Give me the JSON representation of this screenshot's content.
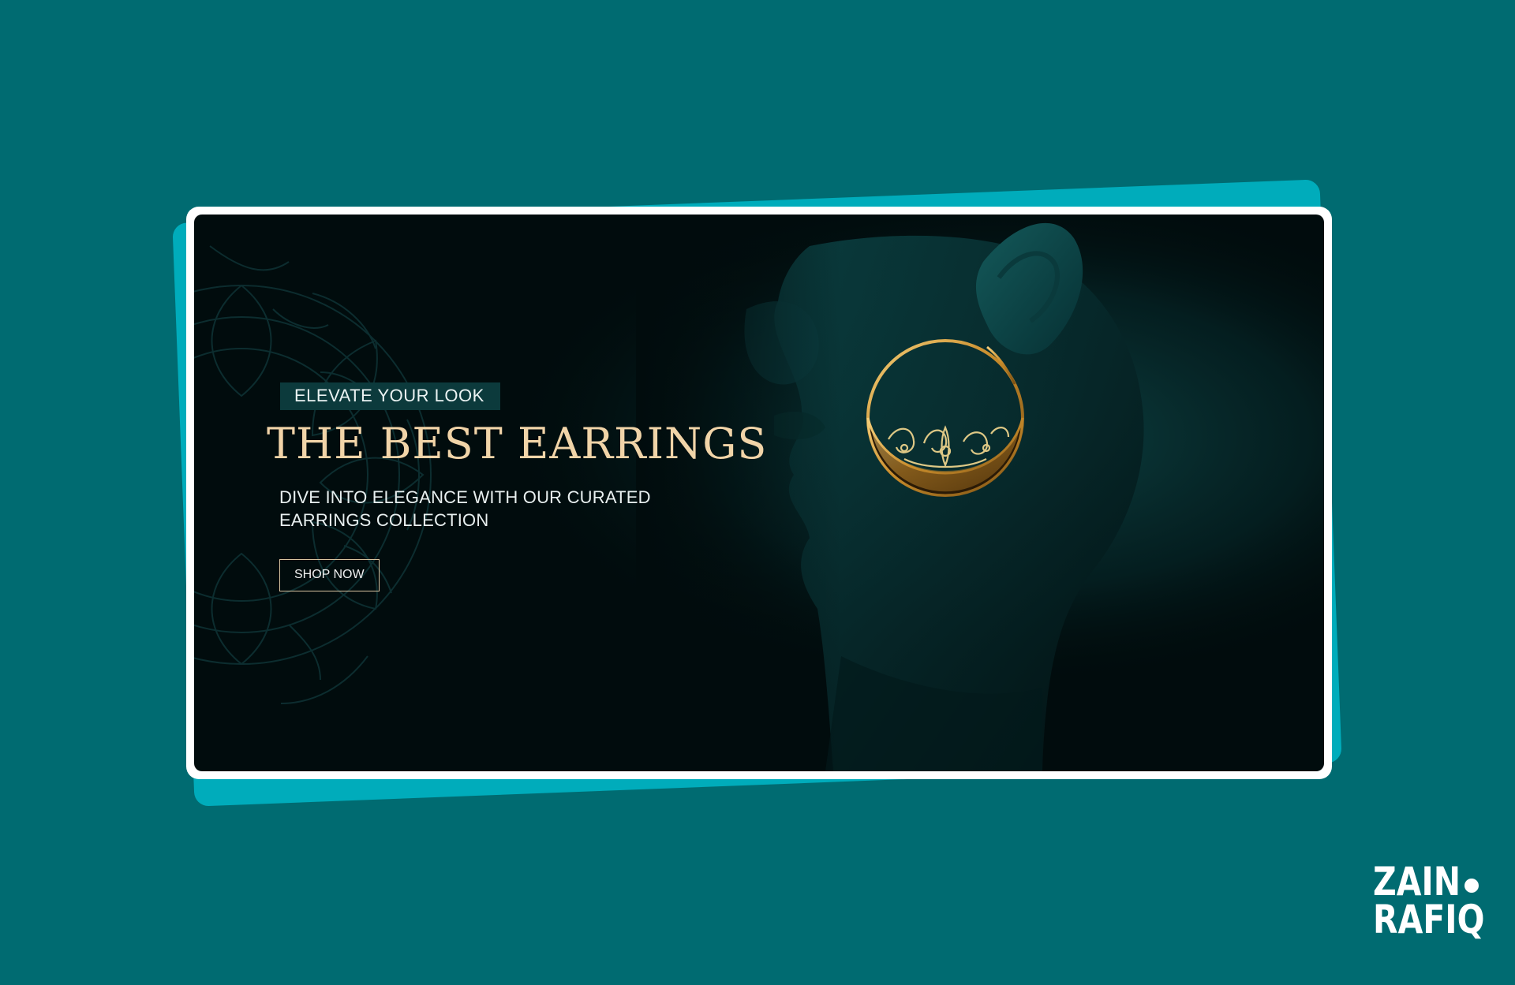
{
  "banner": {
    "eyebrow": "ELEVATE YOUR LOOK",
    "headline": "THE BEST EARRINGS",
    "subtext": "DIVE INTO ELEGANCE WITH OUR CURATED EARRINGS COLLECTION",
    "cta_label": "SHOP NOW"
  },
  "logo": {
    "line1": "ZAIN",
    "line2": "RAFIQ"
  },
  "colors": {
    "background": "#006b71",
    "card_accent": "#00acbb",
    "banner_bg": "#010c0d",
    "headline_gold": "#f1d4a8",
    "eyebrow_bg": "#0c3a3c"
  },
  "icons": {
    "decoration": "mandala-icon",
    "product": "hoop-earring-icon"
  }
}
